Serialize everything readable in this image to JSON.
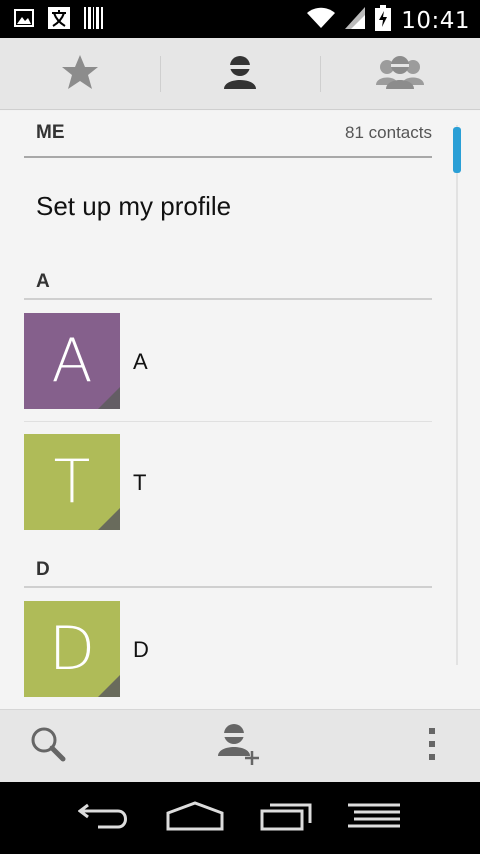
{
  "status_bar": {
    "time": "10:41",
    "icons": [
      "image-icon",
      "translate-icon",
      "barcode-icon",
      "wifi-icon",
      "signal-icon",
      "battery-charging-icon"
    ]
  },
  "tabs": [
    {
      "name": "favorites",
      "icon": "star-icon",
      "selected": false
    },
    {
      "name": "contacts",
      "icon": "person-icon",
      "selected": true
    },
    {
      "name": "groups",
      "icon": "group-icon",
      "selected": false
    }
  ],
  "me_section": {
    "label": "ME",
    "count": "81 contacts",
    "profile_prompt": "Set up my profile"
  },
  "sections": [
    {
      "header": "A",
      "contacts": [
        {
          "letter": "A",
          "name": "A",
          "color": "#85608c"
        },
        {
          "letter": "T",
          "name": "T",
          "color": "#afbb58"
        }
      ]
    },
    {
      "header": "D",
      "contacts": [
        {
          "letter": "D",
          "name": "D",
          "color": "#afbb58"
        }
      ]
    }
  ],
  "accent_color": "#2a9fd6",
  "action_bar": [
    "search-icon",
    "add-contact-icon",
    "overflow-menu-icon"
  ],
  "nav_bar": [
    "back-icon",
    "home-icon",
    "recent-apps-icon",
    "menu-icon"
  ]
}
